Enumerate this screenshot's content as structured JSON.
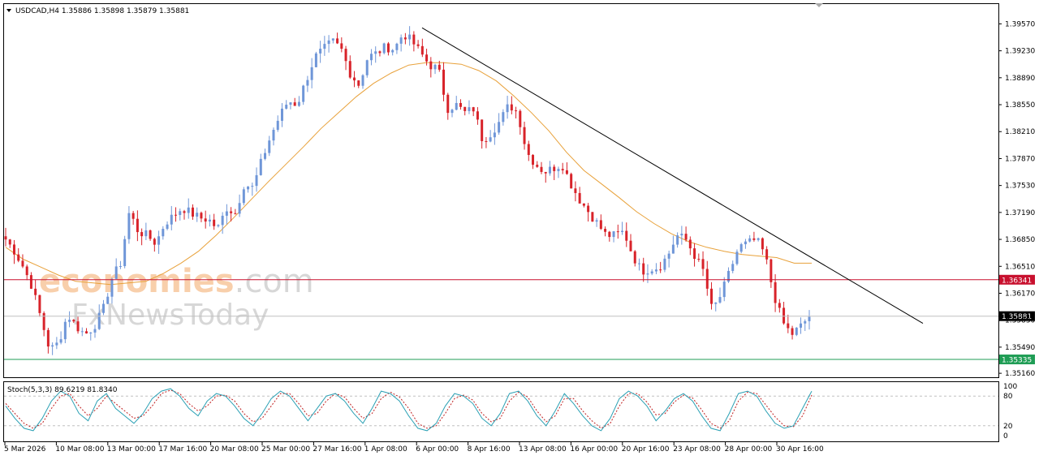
{
  "header": {
    "symbol_line": "USDCAD,H4  1.35886 1.35898 1.35879 1.35881"
  },
  "watermark": {
    "line1_a": "economies",
    "line1_b": ".com",
    "line2": "FxNewsToday"
  },
  "chart_data": {
    "type": "candlestick",
    "symbol": "USDCAD",
    "timeframe": "H4",
    "last_quote": {
      "open": 1.35886,
      "high": 1.35898,
      "low": 1.35879,
      "close": 1.35881
    },
    "y_ticks": [
      "1.39570",
      "1.39230",
      "1.38890",
      "1.38550",
      "1.38210",
      "1.37870",
      "1.37530",
      "1.37190",
      "1.36850",
      "1.36510",
      "1.36170",
      "1.35830",
      "1.35490",
      "1.35160"
    ],
    "x_ticks": [
      "5 Mar 2026",
      "10 Mar 08:00",
      "13 Mar 00:00",
      "17 Mar 16:00",
      "20 Mar 08:00",
      "25 Mar 00:00",
      "27 Mar 16:00",
      "1 Apr 08:00",
      "6 Apr 00:00",
      "8 Apr 16:00",
      "13 Apr 08:00",
      "16 Apr 00:00",
      "20 Apr 16:00",
      "23 Apr 08:00",
      "28 Apr 00:00",
      "30 Apr 16:00"
    ],
    "ylim": [
      1.3511,
      1.3982
    ],
    "price_path": [
      1.3685,
      1.367,
      1.365,
      1.3625,
      1.3585,
      1.3545,
      1.3555,
      1.359,
      1.3575,
      1.3565,
      1.3575,
      1.3595,
      1.3635,
      1.3655,
      1.372,
      1.3695,
      1.369,
      1.368,
      1.3705,
      1.3715,
      1.3725,
      1.3718,
      1.3712,
      1.371,
      1.3698,
      1.3725,
      1.3718,
      1.3755,
      1.375,
      1.3785,
      1.3815,
      1.384,
      1.386,
      1.3855,
      1.3885,
      1.3915,
      1.3925,
      1.3935,
      1.3925,
      1.3895,
      1.388,
      1.3915,
      1.392,
      1.3928,
      1.3925,
      1.3945,
      1.3935,
      1.392,
      1.3905,
      1.39,
      1.385,
      1.3855,
      1.3845,
      1.385,
      1.381,
      1.382,
      1.3835,
      1.3855,
      1.3845,
      1.3795,
      1.378,
      1.377,
      1.3775,
      1.378,
      1.3755,
      1.3735,
      1.372,
      1.3705,
      1.369,
      1.369,
      1.3695,
      1.3665,
      1.3645,
      1.3648,
      1.365,
      1.3665,
      1.369,
      1.3685,
      1.3665,
      1.3645,
      1.3595,
      1.3615,
      1.3645,
      1.3675,
      1.368,
      1.3685,
      1.3665,
      1.3615,
      1.358,
      1.3565,
      1.3575,
      1.3588
    ],
    "indicators": {
      "moving_average_path": [
        1.3675,
        1.366,
        1.365,
        1.364,
        1.3632,
        1.363,
        1.3628,
        1.363,
        1.3632,
        1.3642,
        1.3655,
        1.367,
        1.369,
        1.3712,
        1.3735,
        1.3758,
        1.378,
        1.3802,
        1.3825,
        1.3845,
        1.3865,
        1.3882,
        1.3895,
        1.3905,
        1.3908,
        1.3908,
        1.3906,
        1.3898,
        1.3885,
        1.3866,
        1.3845,
        1.3822,
        1.3795,
        1.3772,
        1.3755,
        1.3738,
        1.372,
        1.3705,
        1.3692,
        1.3682,
        1.3675,
        1.367,
        1.3666,
        1.3664,
        1.3662,
        1.3655,
        1.3655
      ],
      "resistance_level": {
        "value": "1.36341",
        "color": "#c8102e"
      },
      "support_level": {
        "value": "1.35335",
        "color": "#1f9d55"
      },
      "current_price_label": "1.35881",
      "trendline": {
        "from": {
          "date": "6 Apr 00:00",
          "price": 1.3952
        },
        "to": {
          "date": "after 30 Apr 16:00",
          "price": 1.3579
        }
      }
    },
    "stochastic": {
      "label": "Stoch(5,3,3) 89.6219 81.8340",
      "k": 89.6219,
      "d": 81.834,
      "levels": [
        80,
        20
      ],
      "y_ticks": [
        "100",
        "80",
        "20",
        "0"
      ],
      "k_path": [
        60,
        35,
        15,
        10,
        35,
        70,
        90,
        80,
        45,
        30,
        70,
        85,
        55,
        40,
        25,
        45,
        75,
        90,
        95,
        80,
        55,
        40,
        70,
        85,
        80,
        60,
        35,
        20,
        45,
        75,
        90,
        80,
        55,
        30,
        55,
        80,
        85,
        70,
        45,
        25,
        55,
        90,
        85,
        70,
        40,
        15,
        10,
        25,
        60,
        85,
        80,
        65,
        35,
        20,
        45,
        85,
        90,
        70,
        40,
        20,
        50,
        85,
        65,
        40,
        20,
        10,
        35,
        75,
        90,
        80,
        60,
        30,
        50,
        75,
        85,
        70,
        40,
        15,
        10,
        45,
        85,
        90,
        80,
        50,
        25,
        15,
        20,
        55,
        90
      ],
      "d_path": [
        65,
        45,
        25,
        15,
        25,
        55,
        80,
        85,
        60,
        40,
        55,
        80,
        65,
        50,
        35,
        40,
        60,
        85,
        92,
        85,
        65,
        50,
        60,
        80,
        82,
        70,
        45,
        28,
        35,
        60,
        85,
        85,
        65,
        40,
        45,
        70,
        85,
        78,
        55,
        35,
        45,
        75,
        88,
        78,
        55,
        25,
        15,
        20,
        45,
        75,
        82,
        72,
        45,
        28,
        35,
        70,
        88,
        78,
        50,
        28,
        40,
        75,
        75,
        50,
        30,
        15,
        25,
        60,
        85,
        85,
        68,
        42,
        45,
        68,
        82,
        76,
        52,
        25,
        15,
        30,
        70,
        88,
        85,
        62,
        38,
        20,
        18,
        40,
        82
      ]
    },
    "colors": {
      "bull": "#6f96d8",
      "bear": "#d8232a",
      "ma": "#e8a13a",
      "trendline": "#000000",
      "stoch_main": "#2aa0b4",
      "stoch_signal": "#c02020"
    }
  }
}
